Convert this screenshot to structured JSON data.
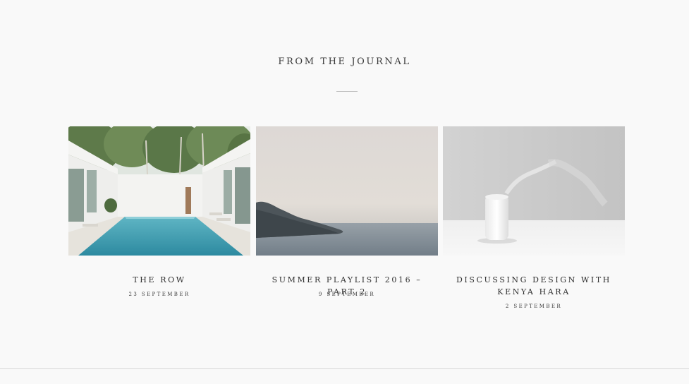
{
  "journal": {
    "heading": "FROM THE JOURNAL",
    "posts": [
      {
        "title": "THE ROW",
        "date": "23 SEPTEMBER",
        "image_icon": "pool-courtyard-photo"
      },
      {
        "title": "SUMMER PLAYLIST 2016 – PART 2",
        "date": "9 SEPTEMBER",
        "image_icon": "hazy-coastline-photo"
      },
      {
        "title": "DISCUSSING DESIGN WITH KENYA HARA",
        "date": "2 SEPTEMBER",
        "image_icon": "aroma-diffuser-photo"
      }
    ]
  }
}
